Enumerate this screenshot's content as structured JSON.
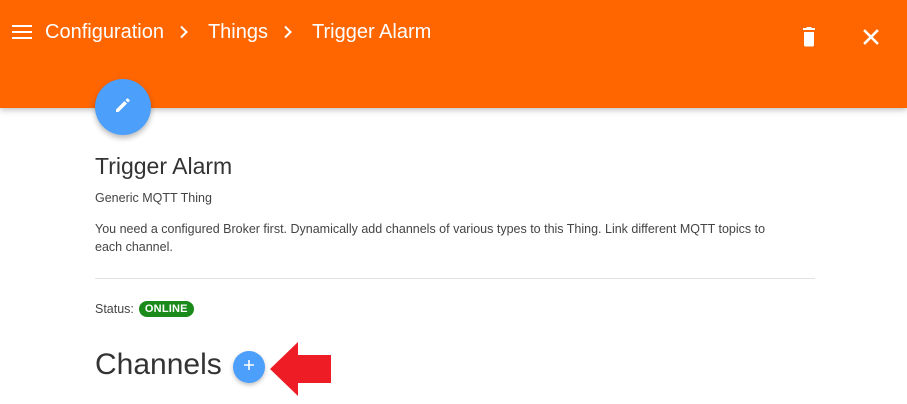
{
  "header": {
    "breadcrumbs": [
      "Configuration",
      "Things",
      "Trigger Alarm"
    ],
    "icons": {
      "menu": "menu-icon",
      "separator": "chevron-right-icon",
      "delete": "trash-icon",
      "close": "close-icon"
    },
    "background_color": "#ff6600"
  },
  "thing": {
    "edit_icon": "pencil-icon",
    "title": "Trigger Alarm",
    "type": "Generic MQTT Thing",
    "description": "You need a configured Broker first. Dynamically add channels of various types to this Thing. Link different MQTT topics to each channel.",
    "status_label": "Status:",
    "status_value": "ONLINE",
    "status_color": "#1a8a1a"
  },
  "channels": {
    "title": "Channels",
    "add_icon": "plus-icon"
  },
  "annotation": {
    "icon": "arrow-left-icon",
    "color": "#ee1c24"
  },
  "accent_color": "#4c9ffa"
}
